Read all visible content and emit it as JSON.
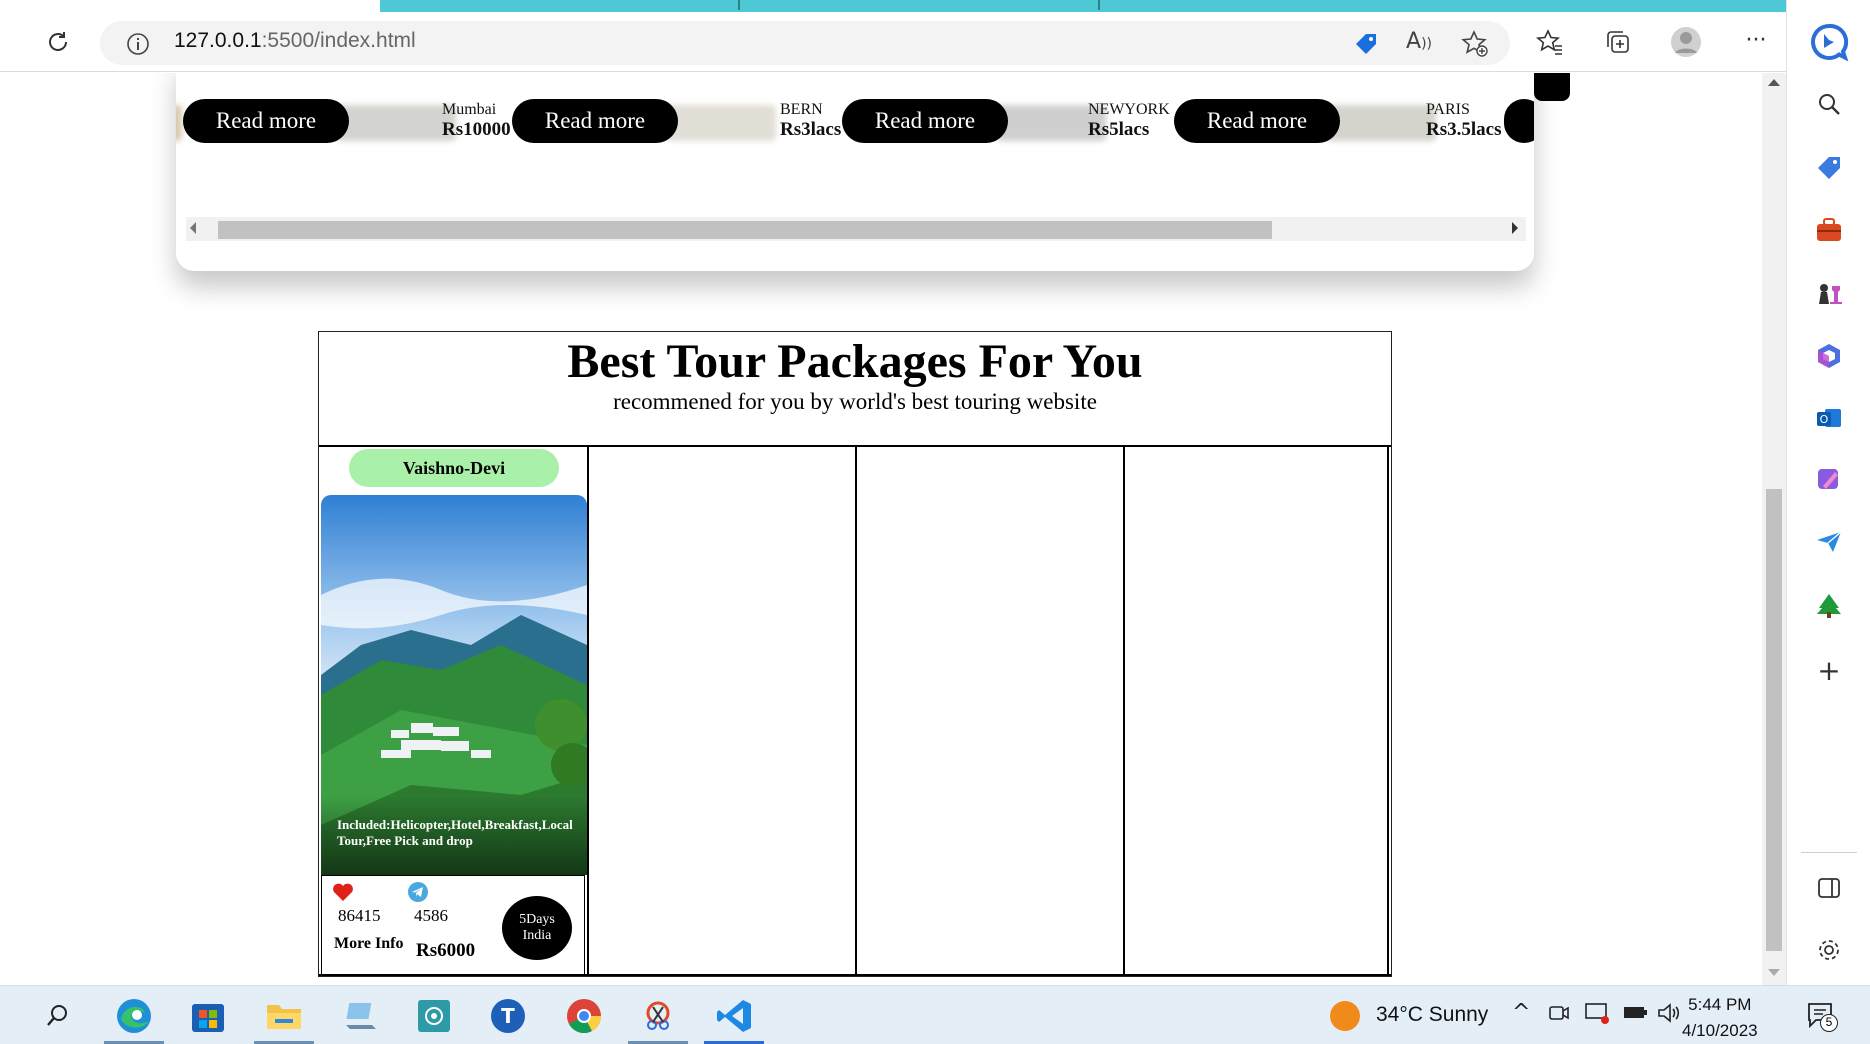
{
  "browser": {
    "url_host": "127.0.0.1",
    "url_rest": ":5500/index.html"
  },
  "carousel": {
    "read_more_label": "Read more",
    "slides": [
      {
        "city": "Mumbai",
        "price": "Rs10000"
      },
      {
        "city": "BERN",
        "price": "Rs3lacs"
      },
      {
        "city": "NEWYORK",
        "price": "Rs5lacs"
      },
      {
        "city": "PARIS",
        "price": "Rs3.5lacs"
      }
    ]
  },
  "packages": {
    "title": "Best Tour Packages For You",
    "subtitle": "recommened for you by world's best touring website",
    "card": {
      "name": "Vaishno-Devi",
      "included": "Included:Helicopter,Hotel,Breakfast,Local Tour,Free Pick and drop",
      "likes": "86415",
      "shares": "4586",
      "more_info": "More Info",
      "price": "Rs6000",
      "days_line1": "5Days",
      "days_line2": "India"
    }
  },
  "taskbar": {
    "weather": "34°C  Sunny",
    "time": "5:44 PM",
    "date": "4/10/2023",
    "notification_count": "5"
  },
  "colors": {
    "tab_strip": "#4cc9d4",
    "card_name_bg": "#a9f0a8",
    "heart": "#e0201b",
    "telegram": "#4aa8e0"
  }
}
